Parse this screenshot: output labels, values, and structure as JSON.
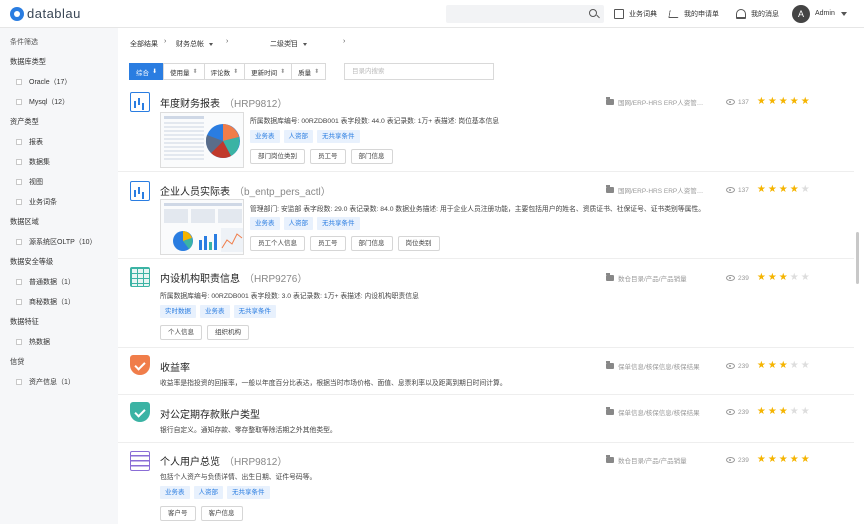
{
  "brand": {
    "name": "datablau"
  },
  "topnav": {
    "search_placeholder": "",
    "links": [
      {
        "label": "业务词典",
        "icon": "book-icon"
      },
      {
        "label": "我的申请单",
        "icon": "cart-icon"
      },
      {
        "label": "我的消息",
        "icon": "bell-icon"
      }
    ],
    "avatar_letter": "A",
    "user_name": "Admin"
  },
  "sidebar": {
    "title": "条件筛选",
    "groups": [
      {
        "heading": "数据库类型",
        "options": [
          {
            "label": "Oracle",
            "count": "（17）"
          },
          {
            "label": "Mysql",
            "count": "（12）"
          }
        ]
      },
      {
        "heading": "资产类型",
        "options": [
          {
            "label": "报表",
            "count": ""
          },
          {
            "label": "数据集",
            "count": ""
          },
          {
            "label": "视图",
            "count": ""
          },
          {
            "label": "业务词条",
            "count": ""
          }
        ]
      },
      {
        "heading": "数据区域",
        "options": [
          {
            "label": "源系统区OLTP",
            "count": "（10）"
          }
        ]
      },
      {
        "heading": "数据安全等级",
        "options": [
          {
            "label": "普通数据",
            "count": "（1）"
          },
          {
            "label": "商秘数据",
            "count": "（1）"
          }
        ]
      },
      {
        "heading": "数据特征",
        "options": [
          {
            "label": "热数据",
            "count": ""
          }
        ]
      },
      {
        "heading": "信贷",
        "options": [
          {
            "label": "资产信息",
            "count": "（1）"
          }
        ]
      }
    ]
  },
  "breadcrumb": {
    "items": [
      "全部结果",
      "财务总帐",
      "",
      "二级类目",
      ""
    ]
  },
  "sort": {
    "buttons": [
      "综合",
      "使用量",
      "评论数",
      "更新时间",
      "质量"
    ],
    "filter_placeholder": "目录内搜索"
  },
  "results": [
    {
      "title": "年度财务报表",
      "code": "（HRP9812）",
      "icon": "bar-chart-icon",
      "desc": "所属数据库编号: 00RZDB001  表字段数: 44.0  表记录数: 1万+  表描述: 岗位基本信息",
      "tags": [
        "业务表",
        "人资部",
        "无共享条件"
      ],
      "columns": [
        "部门岗位类别",
        "员工号",
        "部门信息"
      ],
      "path": "国网/ERP-HRS ERP人资管…",
      "views": "137",
      "rating": 5
    },
    {
      "title": "企业人员实际表",
      "code": "（b_entp_pers_actl）",
      "icon": "bar-chart-icon",
      "desc": "管理部门: 安监部  表字段数: 29.0  表记录数: 84.0  数据业务描述: 用于企业人员注册功能，主要包括用户的姓名、资质证书、社保证号、证书类别等属性。",
      "tags": [
        "业务表",
        "人资部",
        "无共享条件"
      ],
      "columns": [
        "员工个人信息",
        "员工号",
        "部门信息",
        "岗位类别"
      ],
      "path": "国网/ERP-HRS ERP人资管…",
      "views": "137",
      "rating": 4
    },
    {
      "title": "内设机构职责信息",
      "code": "（HRP9276）",
      "icon": "table-icon",
      "desc": "所属数据库编号: 00RZDB001  表字段数: 3.0  表记录数: 1万+  表描述: 内设机构职责信息",
      "tags": [
        "实时数据",
        "业务表",
        "无共享条件"
      ],
      "columns": [
        "个人信息",
        "组织机构"
      ],
      "path": "数仓目录/产品/产品销量",
      "views": "239",
      "rating": 3
    },
    {
      "title": "收益率",
      "code": "",
      "icon": "shield-check-icon",
      "desc": "收益率是指投资的回报率，一般以年度百分比表达，根据当时市场价格、面值、息票利率以及距离到期日时间计算。",
      "tags": [],
      "columns": [],
      "path": "保单信息/核保信息/核保结果",
      "views": "239",
      "rating": 3
    },
    {
      "title": "对公定期存款账户类型",
      "code": "",
      "icon": "shield-az-icon",
      "desc": "银行自定义。通知存款、零存整取等除活期之外其他类型。",
      "tags": [],
      "columns": [],
      "path": "保单信息/核保信息/核保结果",
      "views": "239",
      "rating": 3
    },
    {
      "title": "个人用户总览",
      "code": "（HRP9812）",
      "icon": "grid-table-icon",
      "desc": "包括个人资产与负债详情、出生日期、证件号码等。",
      "tags": [
        "业务表",
        "人资部",
        "无共享条件"
      ],
      "columns": [
        "客户号",
        "客户信息"
      ],
      "path": "数仓目录/产品/产品销量",
      "views": "239",
      "rating": 5
    }
  ],
  "colors": {
    "accent": "#2a7de1",
    "star": "#f5b400",
    "star_off": "#dddddd"
  }
}
